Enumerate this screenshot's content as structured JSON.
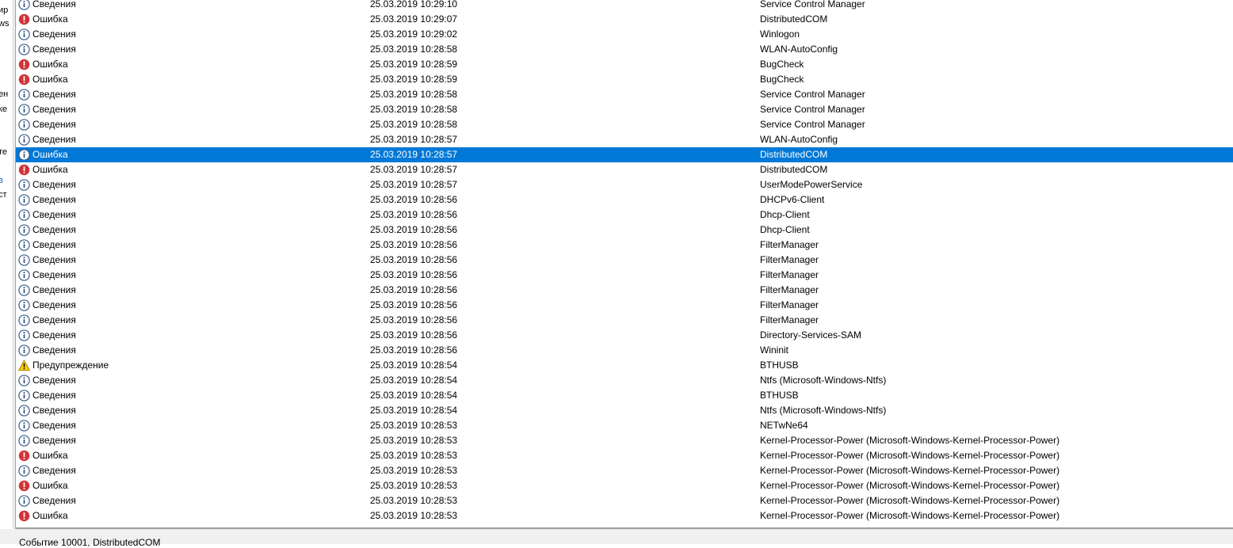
{
  "left_pane": {
    "fragments": [
      "ир",
      "ws",
      "ен",
      "ке",
      "те",
      "в",
      "ст"
    ]
  },
  "events": [
    {
      "level": "Сведения",
      "type": "info",
      "datetime": "25.03.2019 10:29:10",
      "source": "Service Control Manager"
    },
    {
      "level": "Ошибка",
      "type": "error",
      "datetime": "25.03.2019 10:29:07",
      "source": "DistributedCOM"
    },
    {
      "level": "Сведения",
      "type": "info",
      "datetime": "25.03.2019 10:29:02",
      "source": "Winlogon"
    },
    {
      "level": "Сведения",
      "type": "info",
      "datetime": "25.03.2019 10:28:58",
      "source": "WLAN-AutoConfig"
    },
    {
      "level": "Ошибка",
      "type": "error",
      "datetime": "25.03.2019 10:28:59",
      "source": "BugCheck"
    },
    {
      "level": "Ошибка",
      "type": "error",
      "datetime": "25.03.2019 10:28:59",
      "source": "BugCheck"
    },
    {
      "level": "Сведения",
      "type": "info",
      "datetime": "25.03.2019 10:28:58",
      "source": "Service Control Manager"
    },
    {
      "level": "Сведения",
      "type": "info",
      "datetime": "25.03.2019 10:28:58",
      "source": "Service Control Manager"
    },
    {
      "level": "Сведения",
      "type": "info",
      "datetime": "25.03.2019 10:28:58",
      "source": "Service Control Manager"
    },
    {
      "level": "Сведения",
      "type": "info",
      "datetime": "25.03.2019 10:28:57",
      "source": "WLAN-AutoConfig"
    },
    {
      "level": "Ошибка",
      "type": "info",
      "datetime": "25.03.2019 10:28:57",
      "source": "DistributedCOM",
      "selected": true
    },
    {
      "level": "Ошибка",
      "type": "error",
      "datetime": "25.03.2019 10:28:57",
      "source": "DistributedCOM"
    },
    {
      "level": "Сведения",
      "type": "info",
      "datetime": "25.03.2019 10:28:57",
      "source": "UserModePowerService"
    },
    {
      "level": "Сведения",
      "type": "info",
      "datetime": "25.03.2019 10:28:56",
      "source": "DHCPv6-Client"
    },
    {
      "level": "Сведения",
      "type": "info",
      "datetime": "25.03.2019 10:28:56",
      "source": "Dhcp-Client"
    },
    {
      "level": "Сведения",
      "type": "info",
      "datetime": "25.03.2019 10:28:56",
      "source": "Dhcp-Client"
    },
    {
      "level": "Сведения",
      "type": "info",
      "datetime": "25.03.2019 10:28:56",
      "source": "FilterManager"
    },
    {
      "level": "Сведения",
      "type": "info",
      "datetime": "25.03.2019 10:28:56",
      "source": "FilterManager"
    },
    {
      "level": "Сведения",
      "type": "info",
      "datetime": "25.03.2019 10:28:56",
      "source": "FilterManager"
    },
    {
      "level": "Сведения",
      "type": "info",
      "datetime": "25.03.2019 10:28:56",
      "source": "FilterManager"
    },
    {
      "level": "Сведения",
      "type": "info",
      "datetime": "25.03.2019 10:28:56",
      "source": "FilterManager"
    },
    {
      "level": "Сведения",
      "type": "info",
      "datetime": "25.03.2019 10:28:56",
      "source": "FilterManager"
    },
    {
      "level": "Сведения",
      "type": "info",
      "datetime": "25.03.2019 10:28:56",
      "source": "Directory-Services-SAM"
    },
    {
      "level": "Сведения",
      "type": "info",
      "datetime": "25.03.2019 10:28:56",
      "source": "Wininit"
    },
    {
      "level": "Предупреждение",
      "type": "warning",
      "datetime": "25.03.2019 10:28:54",
      "source": "BTHUSB"
    },
    {
      "level": "Сведения",
      "type": "info",
      "datetime": "25.03.2019 10:28:54",
      "source": "Ntfs (Microsoft-Windows-Ntfs)"
    },
    {
      "level": "Сведения",
      "type": "info",
      "datetime": "25.03.2019 10:28:54",
      "source": "BTHUSB"
    },
    {
      "level": "Сведения",
      "type": "info",
      "datetime": "25.03.2019 10:28:54",
      "source": "Ntfs (Microsoft-Windows-Ntfs)"
    },
    {
      "level": "Сведения",
      "type": "info",
      "datetime": "25.03.2019 10:28:53",
      "source": "NETwNe64"
    },
    {
      "level": "Сведения",
      "type": "info",
      "datetime": "25.03.2019 10:28:53",
      "source": "Kernel-Processor-Power (Microsoft-Windows-Kernel-Processor-Power)"
    },
    {
      "level": "Ошибка",
      "type": "error",
      "datetime": "25.03.2019 10:28:53",
      "source": "Kernel-Processor-Power (Microsoft-Windows-Kernel-Processor-Power)"
    },
    {
      "level": "Сведения",
      "type": "info",
      "datetime": "25.03.2019 10:28:53",
      "source": "Kernel-Processor-Power (Microsoft-Windows-Kernel-Processor-Power)"
    },
    {
      "level": "Ошибка",
      "type": "error",
      "datetime": "25.03.2019 10:28:53",
      "source": "Kernel-Processor-Power (Microsoft-Windows-Kernel-Processor-Power)"
    },
    {
      "level": "Сведения",
      "type": "info",
      "datetime": "25.03.2019 10:28:53",
      "source": "Kernel-Processor-Power (Microsoft-Windows-Kernel-Processor-Power)"
    },
    {
      "level": "Ошибка",
      "type": "error",
      "datetime": "25.03.2019 10:28:53",
      "source": "Kernel-Processor-Power (Microsoft-Windows-Kernel-Processor-Power)"
    }
  ],
  "status_bar": {
    "text": "Событие 10001, DistributedCOM"
  },
  "colors": {
    "selection": "#0078d7",
    "error": "#d13438",
    "info": "#2b5797",
    "warning": "#ffcc00"
  }
}
